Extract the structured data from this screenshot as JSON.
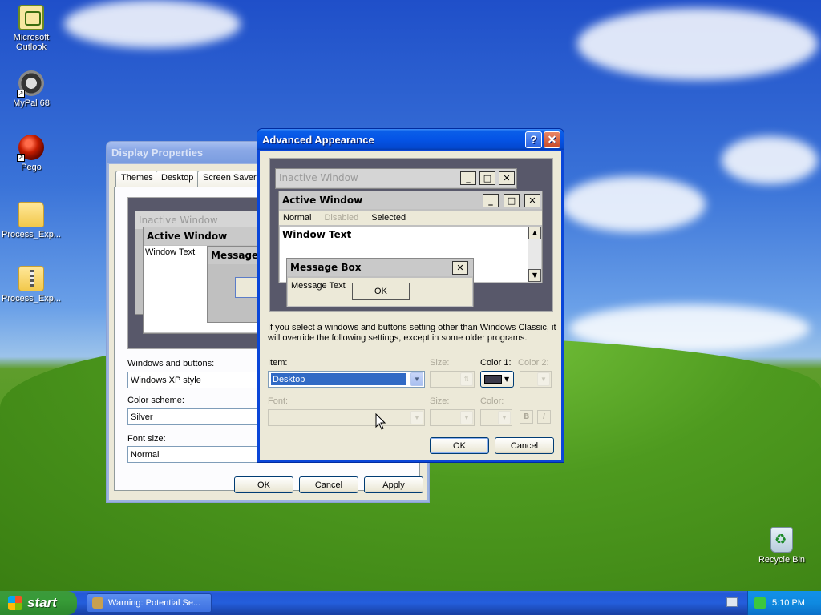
{
  "desktop": {
    "icons": [
      {
        "label": "Microsoft Outlook",
        "icon": "outlook-icon"
      },
      {
        "label": "MyPal 68",
        "icon": "mypal-icon"
      },
      {
        "label": "Pego",
        "icon": "pego-icon"
      },
      {
        "label": "Process_Exp...",
        "icon": "folder-icon"
      },
      {
        "label": "Process_Exp...",
        "icon": "zip-folder-icon"
      },
      {
        "label": "Recycle Bin",
        "icon": "recycle-bin-icon"
      }
    ]
  },
  "display_properties": {
    "title": "Display Properties",
    "tabs": [
      "Themes",
      "Desktop",
      "Screen Saver"
    ],
    "preview": {
      "inactive_window": "Inactive Window",
      "active_window": "Active Window",
      "window_text": "Window Text",
      "message": "Message"
    },
    "windows_and_buttons_label": "Windows and buttons:",
    "windows_and_buttons_value": "Windows XP style",
    "color_scheme_label": "Color scheme:",
    "color_scheme_value": "Silver",
    "font_size_label": "Font size:",
    "font_size_value": "Normal",
    "ok": "OK",
    "cancel": "Cancel",
    "apply": "Apply"
  },
  "advanced_appearance": {
    "title": "Advanced Appearance",
    "preview": {
      "inactive_window": "Inactive Window",
      "active_window": "Active Window",
      "menu_normal": "Normal",
      "menu_disabled": "Disabled",
      "menu_selected": "Selected",
      "window_text": "Window Text",
      "message_box": "Message Box",
      "message_text": "Message Text",
      "ok": "OK"
    },
    "notice": "If you select a windows and buttons setting other than Windows Classic, it will override the following settings, except in some older programs.",
    "item_label": "Item:",
    "item_value": "Desktop",
    "size_label": "Size:",
    "color1_label": "Color 1:",
    "color2_label": "Color 2:",
    "font_label": "Font:",
    "font_size_label": "Size:",
    "font_color_label": "Color:",
    "bold": "B",
    "italic": "I",
    "color1_value": "#3a3a4a",
    "ok": "OK",
    "cancel": "Cancel"
  },
  "taskbar": {
    "start": "start",
    "task_button": "Warning: Potential Se...",
    "clock": "5:10 PM"
  }
}
